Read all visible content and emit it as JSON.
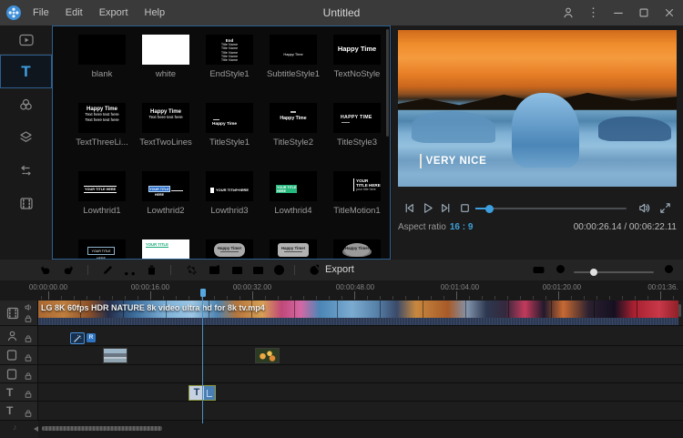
{
  "titlebar": {
    "title": "Untitled",
    "menus": [
      "File",
      "Edit",
      "Export",
      "Help"
    ]
  },
  "sidebar": {
    "text_tab": "T"
  },
  "panel": {
    "items": [
      {
        "label": "blank"
      },
      {
        "label": "white"
      },
      {
        "label": "EndStyle1",
        "thumb": [
          "End",
          "Title Name",
          "Title Name",
          "Title Name",
          "Title Name",
          "Title Name"
        ]
      },
      {
        "label": "SubtitleStyle1",
        "thumb": [
          "Happy Time"
        ]
      },
      {
        "label": "TextNoStyle",
        "thumb": [
          "Happy Time"
        ]
      },
      {
        "label": "TextThreeLi...",
        "thumb": [
          "Happy Time",
          "Text here text here",
          "Text here text here"
        ]
      },
      {
        "label": "TextTwoLines",
        "thumb": [
          "Happy Time",
          "Text here text here"
        ]
      },
      {
        "label": "TitleStyle1",
        "thumb": [
          "Happy Time"
        ]
      },
      {
        "label": "TitleStyle2",
        "thumb": [
          "Happy Time"
        ]
      },
      {
        "label": "TitleStyle3",
        "thumb": [
          "HAPPY TIME"
        ]
      },
      {
        "label": "Lowthrid1",
        "thumb": [
          "YOUR TITLE HERE"
        ]
      },
      {
        "label": "Lowthrid2",
        "thumb": [
          "YOUR TITLE HERE"
        ]
      },
      {
        "label": "Lowthrid3",
        "thumb": [
          "YOUR TITLE HERE"
        ]
      },
      {
        "label": "Lowthrid4",
        "thumb": [
          "YOUR TITLE HERE"
        ]
      },
      {
        "label": "TitleMotion1",
        "thumb": [
          "YOUR TITLE HERE",
          "your title here"
        ]
      }
    ],
    "partial_items": [
      {
        "thumb": "YOUR TITLE HERE"
      },
      {
        "thumb": "YOUR TITLE"
      },
      {
        "thumb": "Happy Time!"
      },
      {
        "thumb": "Happy Time!"
      },
      {
        "thumb": "Happy Time!"
      }
    ]
  },
  "preview": {
    "overlay_text": "VERY NICE",
    "aspect_label": "Aspect ratio",
    "aspect_value": "16 : 9",
    "timecode": "00:00:26.14 / 00:06:22.11"
  },
  "toolbar": {
    "export_label": "Export"
  },
  "timeline": {
    "ruler": [
      "00:00:00.00",
      "00:00:16.00",
      "00:00:32.00",
      "00:00:48.00",
      "00:01:04.00",
      "00:01:20.00",
      "00:01:36."
    ],
    "video_filename": "LG 8K 60fps HDR NATURE 8k video ultra hd for 8k tv.mp4",
    "effect_badge": "R",
    "text_clip_label": "T",
    "text_track_icon": "T"
  }
}
